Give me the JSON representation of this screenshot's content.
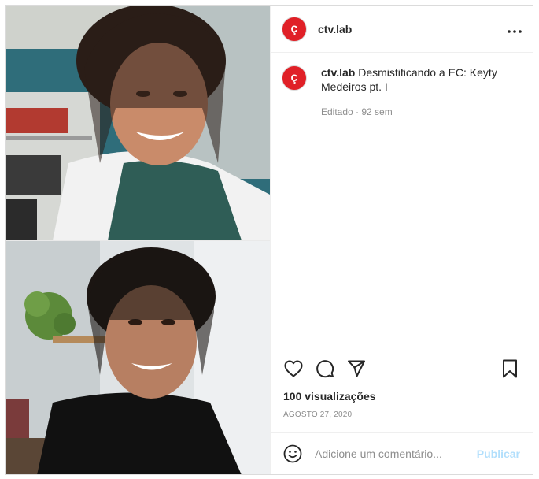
{
  "post": {
    "username": "ctv.lab",
    "logo_glyph": "ç",
    "brand_color": "#e02027"
  },
  "caption": {
    "username": "ctv.lab",
    "text": "Desmistificando a EC: Keyty Medeiros pt. I",
    "meta": "Editado · 92 sem"
  },
  "stats": {
    "views": "100 visualizações",
    "date": "AGOSTO 27, 2020"
  },
  "comment": {
    "placeholder": "Adicione um comentário...",
    "publish_label": "Publicar"
  },
  "icons": {
    "more": "more-options-icon",
    "like": "heart-icon",
    "comment": "comment-bubble-icon",
    "share": "paper-plane-icon",
    "save": "bookmark-icon",
    "emoji": "smiley-icon"
  }
}
